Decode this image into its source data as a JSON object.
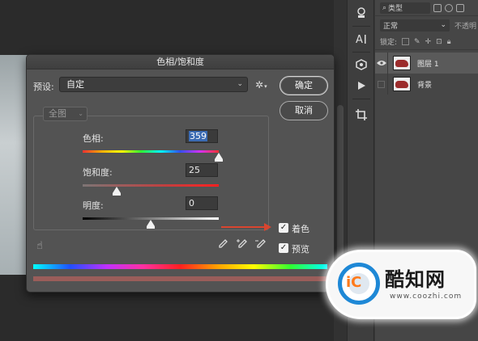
{
  "dialog": {
    "title": "色相/饱和度",
    "preset_label": "预设:",
    "preset_value": "自定",
    "ok_label": "确定",
    "cancel_label": "取消",
    "channel_value": "全图"
  },
  "sliders": [
    {
      "label": "色相:",
      "value": "359",
      "level_fraction": 1.0,
      "color": "#3b6bb3"
    },
    {
      "label": "饱和度:",
      "value": "25",
      "level_fraction": 0.25
    },
    {
      "label": "明度:",
      "value": "0",
      "level_fraction": 0.5
    }
  ],
  "checkboxes": {
    "colorize_label": "着色",
    "colorize_checked": true,
    "preview_label": "预览",
    "preview_checked": true
  },
  "layers_panel": {
    "filter_label": "类型",
    "blend_mode": "正常",
    "opacity_label": "不透明",
    "lock_label": "锁定:",
    "layers": [
      {
        "name": "图层 1",
        "visible": true,
        "active": true
      },
      {
        "name": "背景",
        "visible": false,
        "active": false
      }
    ]
  },
  "watermark": {
    "logo_text": "酷知网",
    "url": "www.coozhi.com"
  },
  "colors": {
    "arrow": "#d9452f",
    "result_bar": "#9a5d5a",
    "dialog_bg": "#535353"
  }
}
